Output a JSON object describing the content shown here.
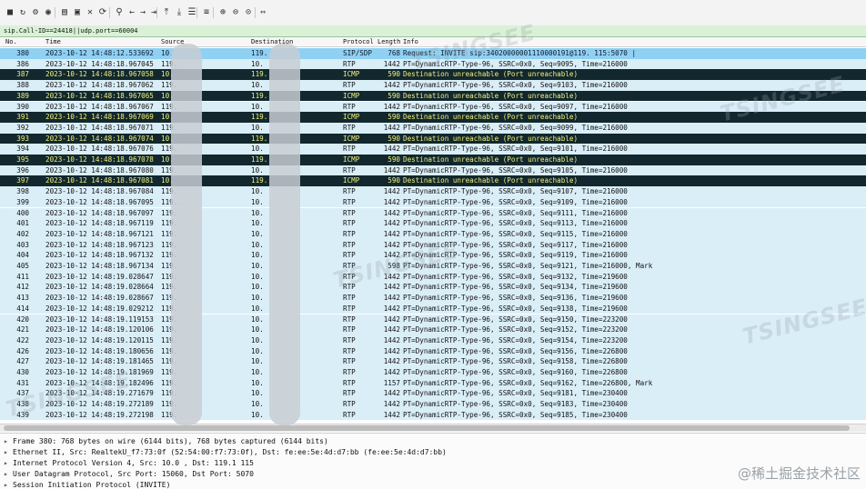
{
  "toolbar": {
    "icons": [
      "stop-icon",
      "restart-icon",
      "options-icon",
      "record-icon",
      "open-file-icon",
      "save-file-icon",
      "close-file-icon",
      "reload-icon",
      "find-packet-icon",
      "go-back-icon",
      "go-forward-icon",
      "go-to-packet-icon",
      "first-packet-icon",
      "last-packet-icon",
      "autoscroll-icon",
      "colorize-icon",
      "zoom-in-icon",
      "zoom-out-icon",
      "zoom-normal-icon",
      "resize-columns-icon"
    ]
  },
  "filter": {
    "value": "sip.Call-ID==24418||udp.port==60004"
  },
  "columns": [
    "No.",
    "Time",
    "Source",
    "Destination",
    "Protocol",
    "Length",
    "Info"
  ],
  "packets": [
    {
      "no": "380",
      "time": "2023-10-12 14:48:12.533692",
      "src": "10.",
      "dst": "119.",
      "proto": "SIP/SDP",
      "len": "768",
      "info": "Request: INVITE sip:34020000001110000191@119.          115:5070  |",
      "style": "sel"
    },
    {
      "no": "386",
      "time": "2023-10-12 14:48:18.967045",
      "src": "119.",
      "dst": "10.",
      "proto": "RTP",
      "len": "1442",
      "info": "PT=DynamicRTP-Type-96, SSRC=0x0, Seq=9095, Time=216000",
      "style": "rtp"
    },
    {
      "no": "387",
      "time": "2023-10-12 14:48:18.967058",
      "src": "10.",
      "dst": "119.",
      "proto": "ICMP",
      "len": "590",
      "info": "Destination unreachable (Port unreachable)",
      "style": "icmp"
    },
    {
      "no": "388",
      "time": "2023-10-12 14:48:18.967062",
      "src": "119.",
      "dst": "10.",
      "proto": "RTP",
      "len": "1442",
      "info": "PT=DynamicRTP-Type-96, SSRC=0x0, Seq=9103, Time=216000",
      "style": "rtp"
    },
    {
      "no": "389",
      "time": "2023-10-12 14:48:18.967065",
      "src": "10.",
      "dst": "119.",
      "proto": "ICMP",
      "len": "590",
      "info": "Destination unreachable (Port unreachable)",
      "style": "icmp"
    },
    {
      "no": "390",
      "time": "2023-10-12 14:48:18.967067",
      "src": "119.",
      "dst": "10.",
      "proto": "RTP",
      "len": "1442",
      "info": "PT=DynamicRTP-Type-96, SSRC=0x0, Seq=9097, Time=216000",
      "style": "rtp"
    },
    {
      "no": "391",
      "time": "2023-10-12 14:48:18.967069",
      "src": "10.",
      "dst": "119.",
      "proto": "ICMP",
      "len": "590",
      "info": "Destination unreachable (Port unreachable)",
      "style": "icmp"
    },
    {
      "no": "392",
      "time": "2023-10-12 14:48:18.967071",
      "src": "119.",
      "dst": "10.",
      "proto": "RTP",
      "len": "1442",
      "info": "PT=DynamicRTP-Type-96, SSRC=0x0, Seq=9099, Time=216000",
      "style": "rtp"
    },
    {
      "no": "393",
      "time": "2023-10-12 14:48:18.967074",
      "src": "10.",
      "dst": "119.",
      "proto": "ICMP",
      "len": "590",
      "info": "Destination unreachable (Port unreachable)",
      "style": "icmp"
    },
    {
      "no": "394",
      "time": "2023-10-12 14:48:18.967076",
      "src": "119.",
      "dst": "10.",
      "proto": "RTP",
      "len": "1442",
      "info": "PT=DynamicRTP-Type-96, SSRC=0x0, Seq=9101, Time=216000",
      "style": "rtp"
    },
    {
      "no": "395",
      "time": "2023-10-12 14:48:18.967078",
      "src": "10.",
      "dst": "119.",
      "proto": "ICMP",
      "len": "590",
      "info": "Destination unreachable (Port unreachable)",
      "style": "icmp"
    },
    {
      "no": "396",
      "time": "2023-10-12 14:48:18.967080",
      "src": "119.",
      "dst": "10.",
      "proto": "RTP",
      "len": "1442",
      "info": "PT=DynamicRTP-Type-96, SSRC=0x0, Seq=9105, Time=216000",
      "style": "rtp"
    },
    {
      "no": "397",
      "time": "2023-10-12 14:48:18.967081",
      "src": "10.",
      "dst": "119.",
      "proto": "ICMP",
      "len": "590",
      "info": "Destination unreachable (Port unreachable)",
      "style": "icmp"
    },
    {
      "no": "398",
      "time": "2023-10-12 14:48:18.967084",
      "src": "119.",
      "dst": "10.",
      "proto": "RTP",
      "len": "1442",
      "info": "PT=DynamicRTP-Type-96, SSRC=0x0, Seq=9107, Time=216000",
      "style": "rtp"
    },
    {
      "no": "399",
      "time": "2023-10-12 14:48:18.967095",
      "src": "119.",
      "dst": "10.",
      "proto": "RTP",
      "len": "1442",
      "info": "PT=DynamicRTP-Type-96, SSRC=0x0, Seq=9109, Time=216000",
      "style": "rtp"
    },
    {
      "no": "400",
      "time": "2023-10-12 14:48:18.967097",
      "src": "119.",
      "dst": "10.",
      "proto": "RTP",
      "len": "1442",
      "info": "PT=DynamicRTP-Type-96, SSRC=0x0, Seq=9111, Time=216000",
      "style": "rtp"
    },
    {
      "no": "401",
      "time": "2023-10-12 14:48:18.967119",
      "src": "119.",
      "dst": "10.",
      "proto": "RTP",
      "len": "1442",
      "info": "PT=DynamicRTP-Type-96, SSRC=0x0, Seq=9113, Time=216000",
      "style": "rtp"
    },
    {
      "no": "402",
      "time": "2023-10-12 14:48:18.967121",
      "src": "119.",
      "dst": "10.",
      "proto": "RTP",
      "len": "1442",
      "info": "PT=DynamicRTP-Type-96, SSRC=0x0, Seq=9115, Time=216000",
      "style": "rtp"
    },
    {
      "no": "403",
      "time": "2023-10-12 14:48:18.967123",
      "src": "119.",
      "dst": "10.",
      "proto": "RTP",
      "len": "1442",
      "info": "PT=DynamicRTP-Type-96, SSRC=0x0, Seq=9117, Time=216000",
      "style": "rtp"
    },
    {
      "no": "404",
      "time": "2023-10-12 14:48:18.967132",
      "src": "119.",
      "dst": "10.",
      "proto": "RTP",
      "len": "1442",
      "info": "PT=DynamicRTP-Type-96, SSRC=0x0, Seq=9119, Time=216000",
      "style": "rtp"
    },
    {
      "no": "405",
      "time": "2023-10-12 14:48:18.967134",
      "src": "119.",
      "dst": "10.",
      "proto": "RTP",
      "len": "598",
      "info": "PT=DynamicRTP-Type-96, SSRC=0x0, Seq=9121, Time=216000, Mark",
      "style": "rtp"
    },
    {
      "no": "411",
      "time": "2023-10-12 14:48:19.028647",
      "src": "119.",
      "dst": "10.",
      "proto": "RTP",
      "len": "1442",
      "info": "PT=DynamicRTP-Type-96, SSRC=0x0, Seq=9132, Time=219600",
      "style": "rtp"
    },
    {
      "no": "412",
      "time": "2023-10-12 14:48:19.028664",
      "src": "119.",
      "dst": "10.",
      "proto": "RTP",
      "len": "1442",
      "info": "PT=DynamicRTP-Type-96, SSRC=0x0, Seq=9134, Time=219600",
      "style": "rtp"
    },
    {
      "no": "413",
      "time": "2023-10-12 14:48:19.028667",
      "src": "119.",
      "dst": "10.",
      "proto": "RTP",
      "len": "1442",
      "info": "PT=DynamicRTP-Type-96, SSRC=0x0, Seq=9136, Time=219600",
      "style": "rtp"
    },
    {
      "no": "414",
      "time": "2023-10-12 14:48:19.029212",
      "src": "119.",
      "dst": "10.",
      "proto": "RTP",
      "len": "1442",
      "info": "PT=DynamicRTP-Type-96, SSRC=0x0, Seq=9138, Time=219600",
      "style": "rtp"
    },
    {
      "no": "420",
      "time": "2023-10-12 14:48:19.119153",
      "src": "119.",
      "dst": "10.",
      "proto": "RTP",
      "len": "1442",
      "info": "PT=DynamicRTP-Type-96, SSRC=0x0, Seq=9150, Time=223200",
      "style": "rtp"
    },
    {
      "no": "421",
      "time": "2023-10-12 14:48:19.120106",
      "src": "119.",
      "dst": "10.",
      "proto": "RTP",
      "len": "1442",
      "info": "PT=DynamicRTP-Type-96, SSRC=0x0, Seq=9152, Time=223200",
      "style": "rtp"
    },
    {
      "no": "422",
      "time": "2023-10-12 14:48:19.120115",
      "src": "119.",
      "dst": "10.",
      "proto": "RTP",
      "len": "1442",
      "info": "PT=DynamicRTP-Type-96, SSRC=0x0, Seq=9154, Time=223200",
      "style": "rtp"
    },
    {
      "no": "426",
      "time": "2023-10-12 14:48:19.180656",
      "src": "119.",
      "dst": "10.",
      "proto": "RTP",
      "len": "1442",
      "info": "PT=DynamicRTP-Type-96, SSRC=0x0, Seq=9156, Time=226800",
      "style": "rtp"
    },
    {
      "no": "427",
      "time": "2023-10-12 14:48:19.181465",
      "src": "119.",
      "dst": "10.",
      "proto": "RTP",
      "len": "1442",
      "info": "PT=DynamicRTP-Type-96, SSRC=0x0, Seq=9158, Time=226800",
      "style": "rtp"
    },
    {
      "no": "430",
      "time": "2023-10-12 14:48:19.181969",
      "src": "119.",
      "dst": "10.",
      "proto": "RTP",
      "len": "1442",
      "info": "PT=DynamicRTP-Type-96, SSRC=0x0, Seq=9160, Time=226800",
      "style": "rtp"
    },
    {
      "no": "431",
      "time": "2023-10-12 14:48:19.182496",
      "src": "119.",
      "dst": "10.",
      "proto": "RTP",
      "len": "1157",
      "info": "PT=DynamicRTP-Type-96, SSRC=0x0, Seq=9162, Time=226800, Mark",
      "style": "rtp"
    },
    {
      "no": "437",
      "time": "2023-10-12 14:48:19.271679",
      "src": "119.",
      "dst": "10.",
      "proto": "RTP",
      "len": "1442",
      "info": "PT=DynamicRTP-Type-96, SSRC=0x0, Seq=9181, Time=230400",
      "style": "rtp"
    },
    {
      "no": "438",
      "time": "2023-10-12 14:48:19.272189",
      "src": "119.",
      "dst": "10.",
      "proto": "RTP",
      "len": "1442",
      "info": "PT=DynamicRTP-Type-96, SSRC=0x0, Seq=9183, Time=230400",
      "style": "rtp"
    },
    {
      "no": "439",
      "time": "2023-10-12 14:48:19.272198",
      "src": "119.",
      "dst": "10.",
      "proto": "RTP",
      "len": "1442",
      "info": "PT=DynamicRTP-Type-96, SSRC=0x0, Seq=9185, Time=230400",
      "style": "rtp"
    }
  ],
  "details": [
    "Frame 380: 768 bytes on wire (6144 bits), 768 bytes captured (6144 bits)",
    "Ethernet II, Src: RealtekU_f7:73:0f (52:54:00:f7:73:0f), Dst: fe:ee:5e:4d:d7:bb (fe:ee:5e:4d:d7:bb)",
    "Internet Protocol Version 4, Src: 10.0        , Dst: 119.1         115",
    "User Datagram Protocol, Src Port: 15060, Dst Port: 5070",
    "Session Initiation Protocol (INVITE)"
  ],
  "watermark": {
    "text": "TSINGSEE",
    "corner_text": "@稀土掘金技术社区"
  },
  "colors": {
    "selected_row": "#8fd0f3",
    "rtp_row": "#daeef8",
    "icmp_row_bg": "#12272e",
    "icmp_row_fg": "#f2f27a",
    "filter_bg": "#d9f2d6"
  }
}
